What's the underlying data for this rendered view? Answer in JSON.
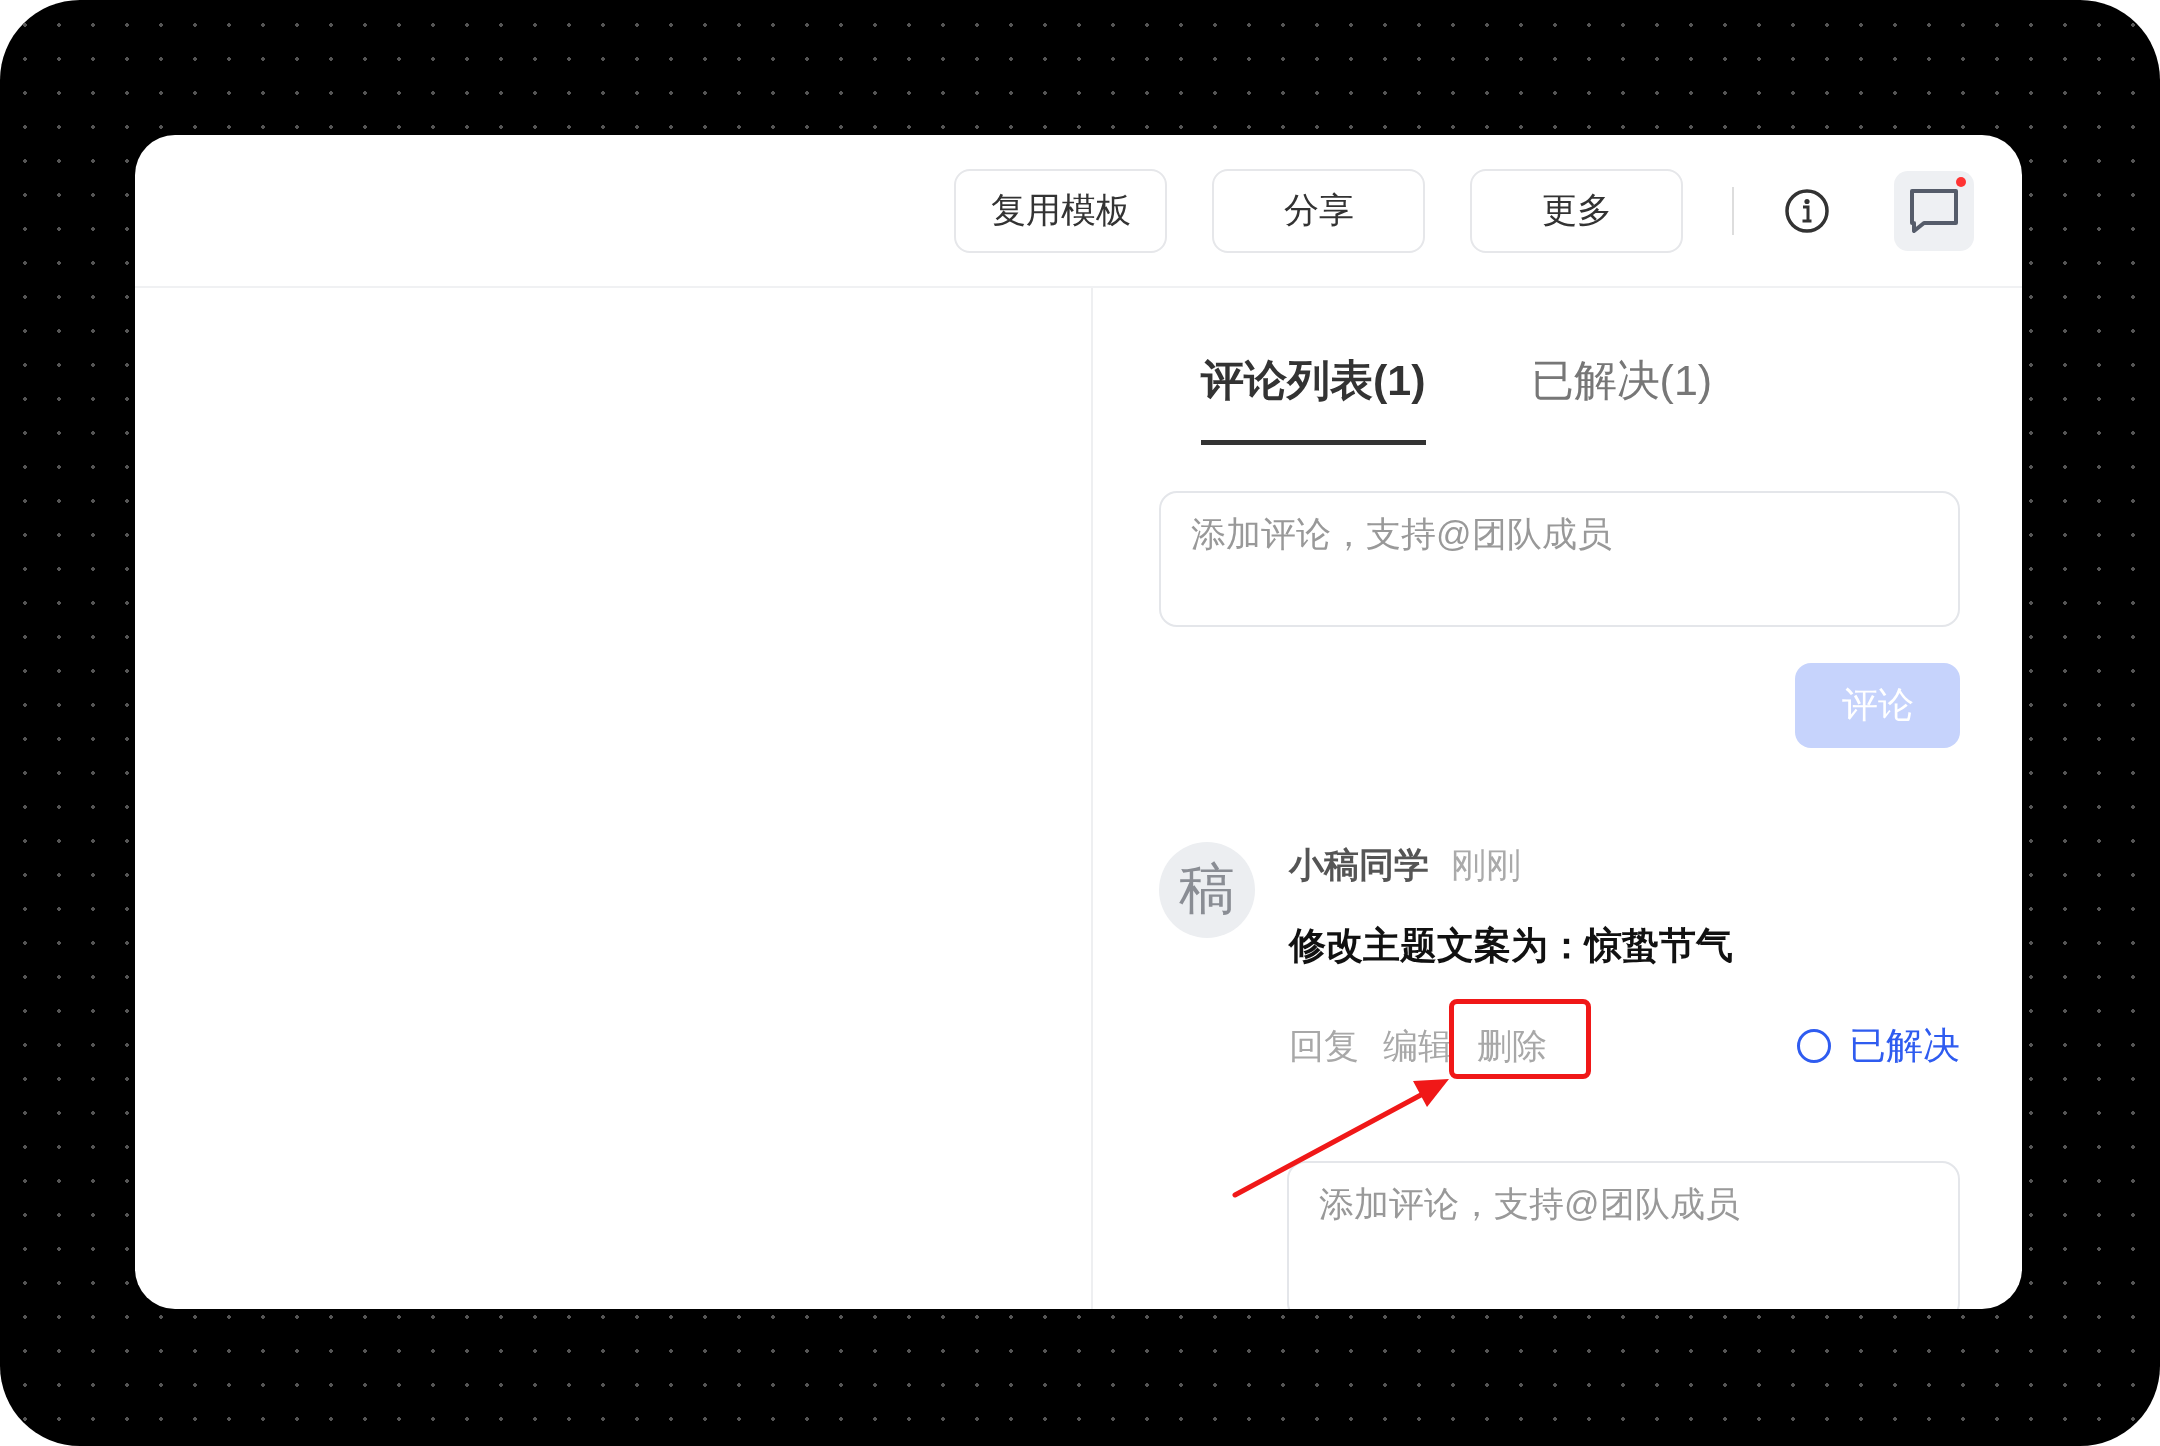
{
  "toolbar": {
    "buttons": [
      {
        "label": "复用模板"
      },
      {
        "label": "分享"
      },
      {
        "label": "更多"
      }
    ],
    "comments_unread": true
  },
  "tabs": [
    {
      "label": "评论列表(1)",
      "selected": true
    },
    {
      "label": "已解决(1)",
      "selected": false
    }
  ],
  "comment_input": {
    "placeholder": "添加评论，支持@团队成员"
  },
  "submit_button": {
    "label": "评论",
    "disabled": true
  },
  "comments": [
    {
      "avatar": "稿",
      "author": "小稿同学",
      "time": "刚刚",
      "body": "修改主题文案为：惊蛰节气",
      "actions": [
        "回复",
        "编辑",
        "删除"
      ],
      "resolve": {
        "label": "已解决",
        "checked": false
      }
    }
  ],
  "reply_input": {
    "placeholder": "添加评论，支持@团队成员"
  }
}
